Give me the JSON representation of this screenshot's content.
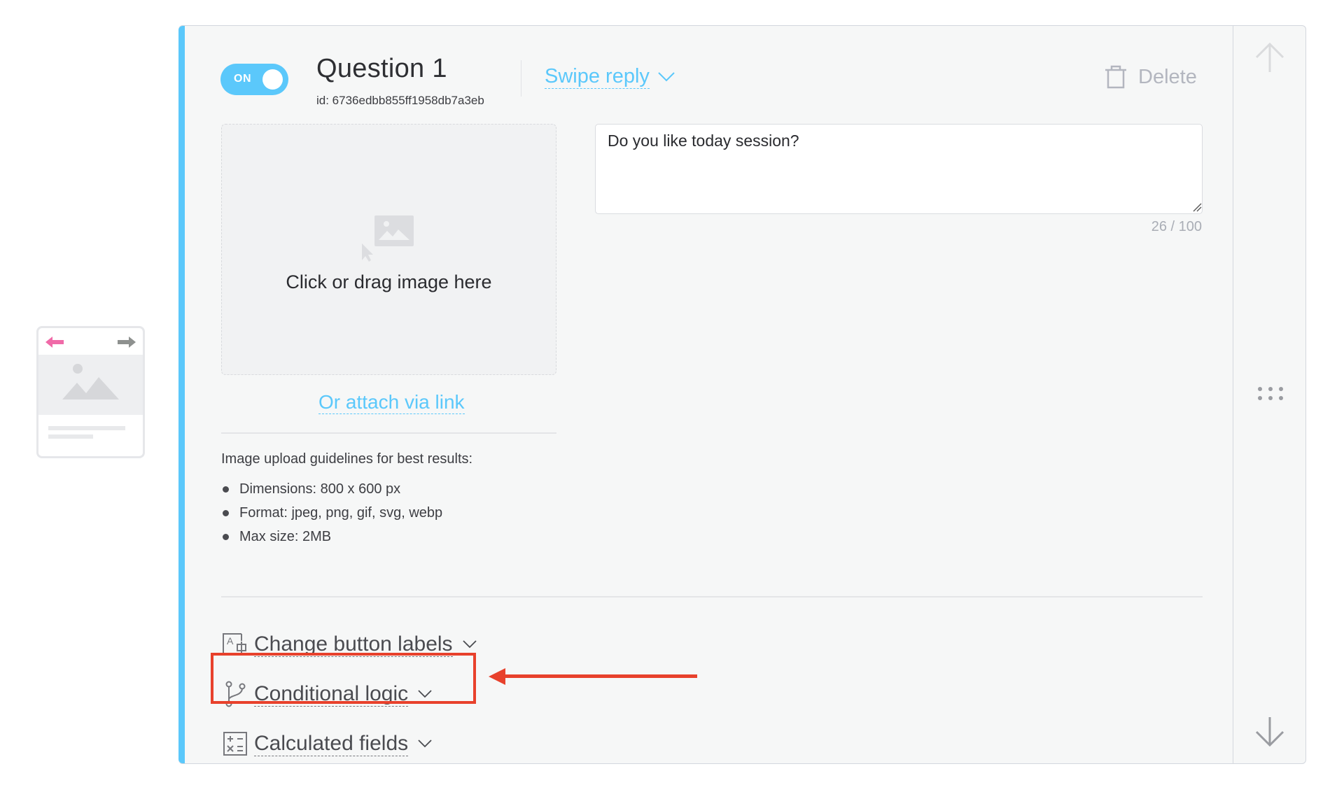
{
  "thumbnail": {
    "arrow_left_color": "#f06aa8",
    "arrow_right_color": "#8e918f",
    "icons": [
      "arrow-left-icon",
      "arrow-right-icon",
      "image-placeholder-icon"
    ]
  },
  "question": {
    "toggle_label": "ON",
    "toggle_state": "on",
    "title": "Question 1",
    "id_text": "id: 6736edbb855ff1958db7a3eb",
    "type_label": "Swipe reply",
    "delete_label": "Delete"
  },
  "image_upload": {
    "dropzone_text": "Click or drag image here",
    "attach_link": "Or attach via link",
    "guidelines_title": "Image upload guidelines for best results:",
    "guidelines": [
      "Dimensions: 800 x 600 px",
      "Format: jpeg, png, gif, svg, webp",
      "Max size: 2MB"
    ]
  },
  "question_text": {
    "value": "Do you like today session?",
    "counter": "26 / 100"
  },
  "options": [
    {
      "label": "Change button labels",
      "icon": "button-labels-icon"
    },
    {
      "label": "Conditional logic",
      "icon": "branch-icon",
      "highlighted": true
    },
    {
      "label": "Calculated fields",
      "icon": "calculator-icon"
    }
  ],
  "colors": {
    "accent": "#5bc8fb",
    "annotation": "#e8412c",
    "muted": "#b3b6bf",
    "card_bg": "#f6f7f7"
  }
}
